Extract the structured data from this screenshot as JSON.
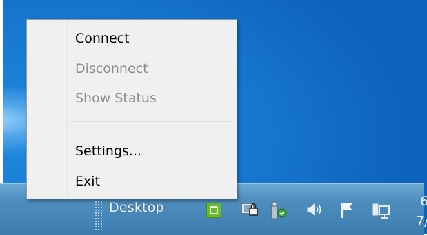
{
  "context_menu": {
    "items": [
      {
        "label": "Connect",
        "enabled": true
      },
      {
        "label": "Disconnect",
        "enabled": false
      },
      {
        "label": "Show Status",
        "enabled": false
      },
      {
        "label": "Settings...",
        "enabled": true
      },
      {
        "label": "Exit",
        "enabled": true
      }
    ]
  },
  "taskbar": {
    "desktop_label": "Desktop",
    "tray_icons": [
      "app-tray-icon",
      "lock-monitor-icon",
      "network-check-icon",
      "volume-icon",
      "action-center-flag-icon",
      "network-monitor-icon"
    ],
    "clock_line1": "6",
    "clock_line2": "7/"
  },
  "colors": {
    "desktop_blue": "#1676cf",
    "taskbar": "#4f8fbf",
    "menu_bg": "#f0f0f0",
    "disabled_text": "#8d8d8d",
    "tray_green": "#69bb2e"
  }
}
